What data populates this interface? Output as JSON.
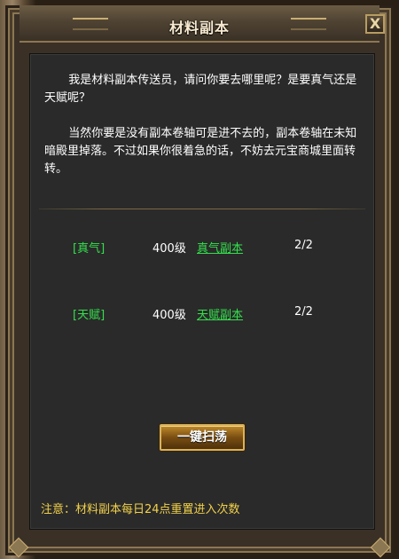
{
  "window": {
    "title": "材料副本",
    "close_label": "X"
  },
  "dialog": {
    "paragraph1": "我是材料副本传送员，请问你要去哪里呢？是要真气还是天赋呢？",
    "paragraph2": "当然你要是没有副本卷轴可是进不去的，副本卷轴在未知暗殿里掉落。不过如果你很着急的话，不妨去元宝商城里面转转。"
  },
  "dungeons": [
    {
      "category": "[真气]",
      "level": "400级",
      "name": "真气副本",
      "count": "2/2"
    },
    {
      "category": "[天赋]",
      "level": "400级",
      "name": "天赋副本",
      "count": "2/2"
    }
  ],
  "sweep_button": "一键扫荡",
  "note": "注意：材料副本每日24点重置进入次数",
  "colors": {
    "accent_green": "#33e04c",
    "note_yellow": "#f2d14a",
    "panel_bg": "#2a2a2a",
    "frame_gold": "#8c7753"
  }
}
